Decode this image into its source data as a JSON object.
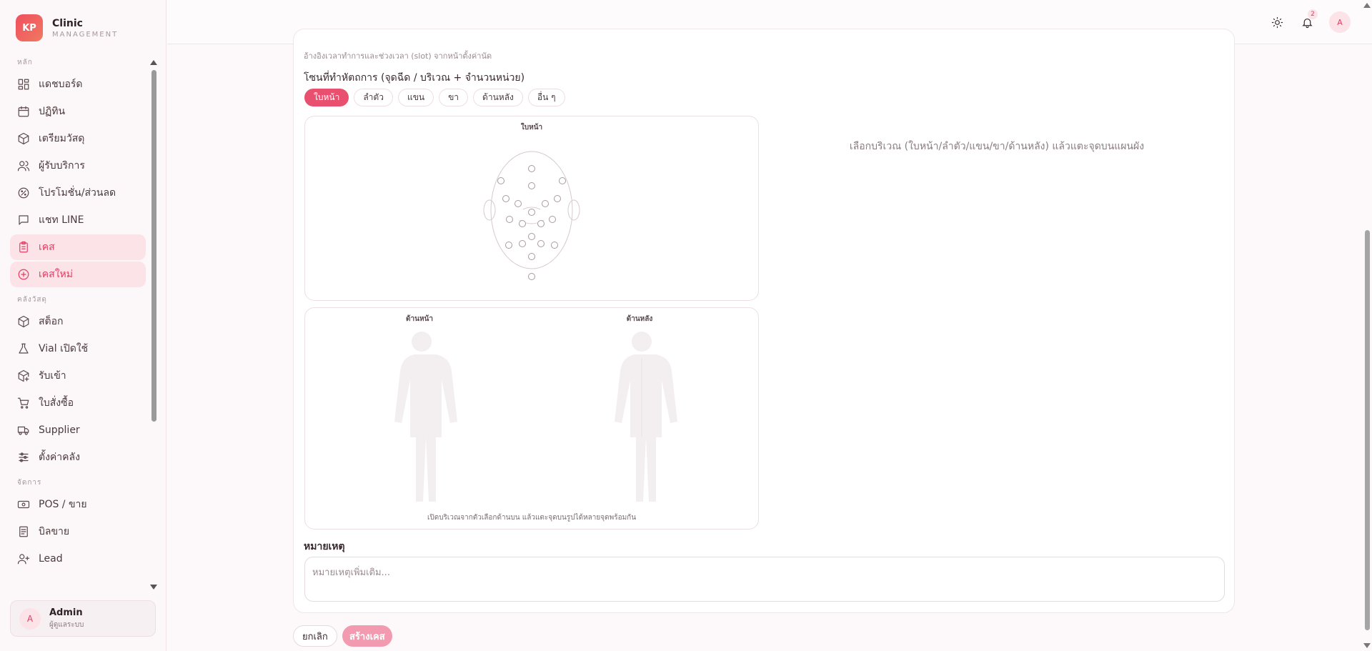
{
  "brand": {
    "logo_text": "KP",
    "title": "Clinic",
    "subtitle": "MANAGEMENT"
  },
  "sidebar": {
    "sections": [
      {
        "label": "หลัก",
        "items": [
          {
            "label": "แดชบอร์ด",
            "icon": "dashboard-icon",
            "active": false
          },
          {
            "label": "ปฏิทิน",
            "icon": "calendar-icon",
            "active": false
          },
          {
            "label": "เตรียมวัสดุ",
            "icon": "package-icon",
            "active": false
          },
          {
            "label": "ผู้รับบริการ",
            "icon": "users-icon",
            "active": false
          },
          {
            "label": "โปรโมชั่น/ส่วนลด",
            "icon": "discount-icon",
            "active": false
          },
          {
            "label": "แชท LINE",
            "icon": "chat-icon",
            "active": false
          },
          {
            "label": "เคส",
            "icon": "clipboard-icon",
            "active": true
          },
          {
            "label": "เคสใหม่",
            "icon": "plus-circle-icon",
            "active": true
          }
        ]
      },
      {
        "label": "คลังวัสดุ",
        "items": [
          {
            "label": "สต็อก",
            "icon": "box-icon",
            "active": false
          },
          {
            "label": "Vial เปิดใช้",
            "icon": "flask-icon",
            "active": false
          },
          {
            "label": "รับเข้า",
            "icon": "package-plus-icon",
            "active": false
          },
          {
            "label": "ใบสั่งซื้อ",
            "icon": "cart-icon",
            "active": false
          },
          {
            "label": "Supplier",
            "icon": "truck-icon",
            "active": false
          },
          {
            "label": "ตั้งค่าคลัง",
            "icon": "sliders-icon",
            "active": false
          }
        ]
      },
      {
        "label": "จัดการ",
        "items": [
          {
            "label": "POS / ขาย",
            "icon": "pos-icon",
            "active": false
          },
          {
            "label": "บิลขาย",
            "icon": "receipt-icon",
            "active": false
          },
          {
            "label": "Lead",
            "icon": "user-plus-icon",
            "active": false
          }
        ]
      }
    ]
  },
  "user": {
    "avatar": "A",
    "name": "Admin",
    "role": "ผู้ดูแลระบบ"
  },
  "topbar": {
    "notifications": "2",
    "avatar": "A"
  },
  "form": {
    "hint_top": "อ้างอิงเวลาทำการและช่วงเวลา (slot) จากหน้าตั้งค่านัด",
    "zone_label": "โซนที่ทำหัตถการ (จุดฉีด / บริเวณ + จำนวนหน่วย)",
    "chips": [
      {
        "label": "ใบหน้า",
        "active": true
      },
      {
        "label": "ลำตัว",
        "active": false
      },
      {
        "label": "แขน",
        "active": false
      },
      {
        "label": "ขา",
        "active": false
      },
      {
        "label": "ด้านหลัง",
        "active": false
      },
      {
        "label": "อื่น ๆ",
        "active": false
      }
    ],
    "face_panel_title": "ใบหน้า",
    "body_front_title": "ด้านหน้า",
    "body_back_title": "ด้านหลัง",
    "body_caption": "เปิดบริเวณจากตัวเลือกด้านบน แล้วแตะจุดบนรูปได้หลายจุดพร้อมกัน",
    "right_hint": "เลือกบริเวณ (ใบหน้า/ลำตัว/แขน/ขา/ด้านหลัง) แล้วแตะจุดบนแผนผัง",
    "notes_label": "หมายเหตุ",
    "notes_placeholder": "หมายเหตุเพิ่มเติม...",
    "notes_value": "",
    "cancel_label": "ยกเลิก",
    "create_label": "สร้างเคส"
  }
}
